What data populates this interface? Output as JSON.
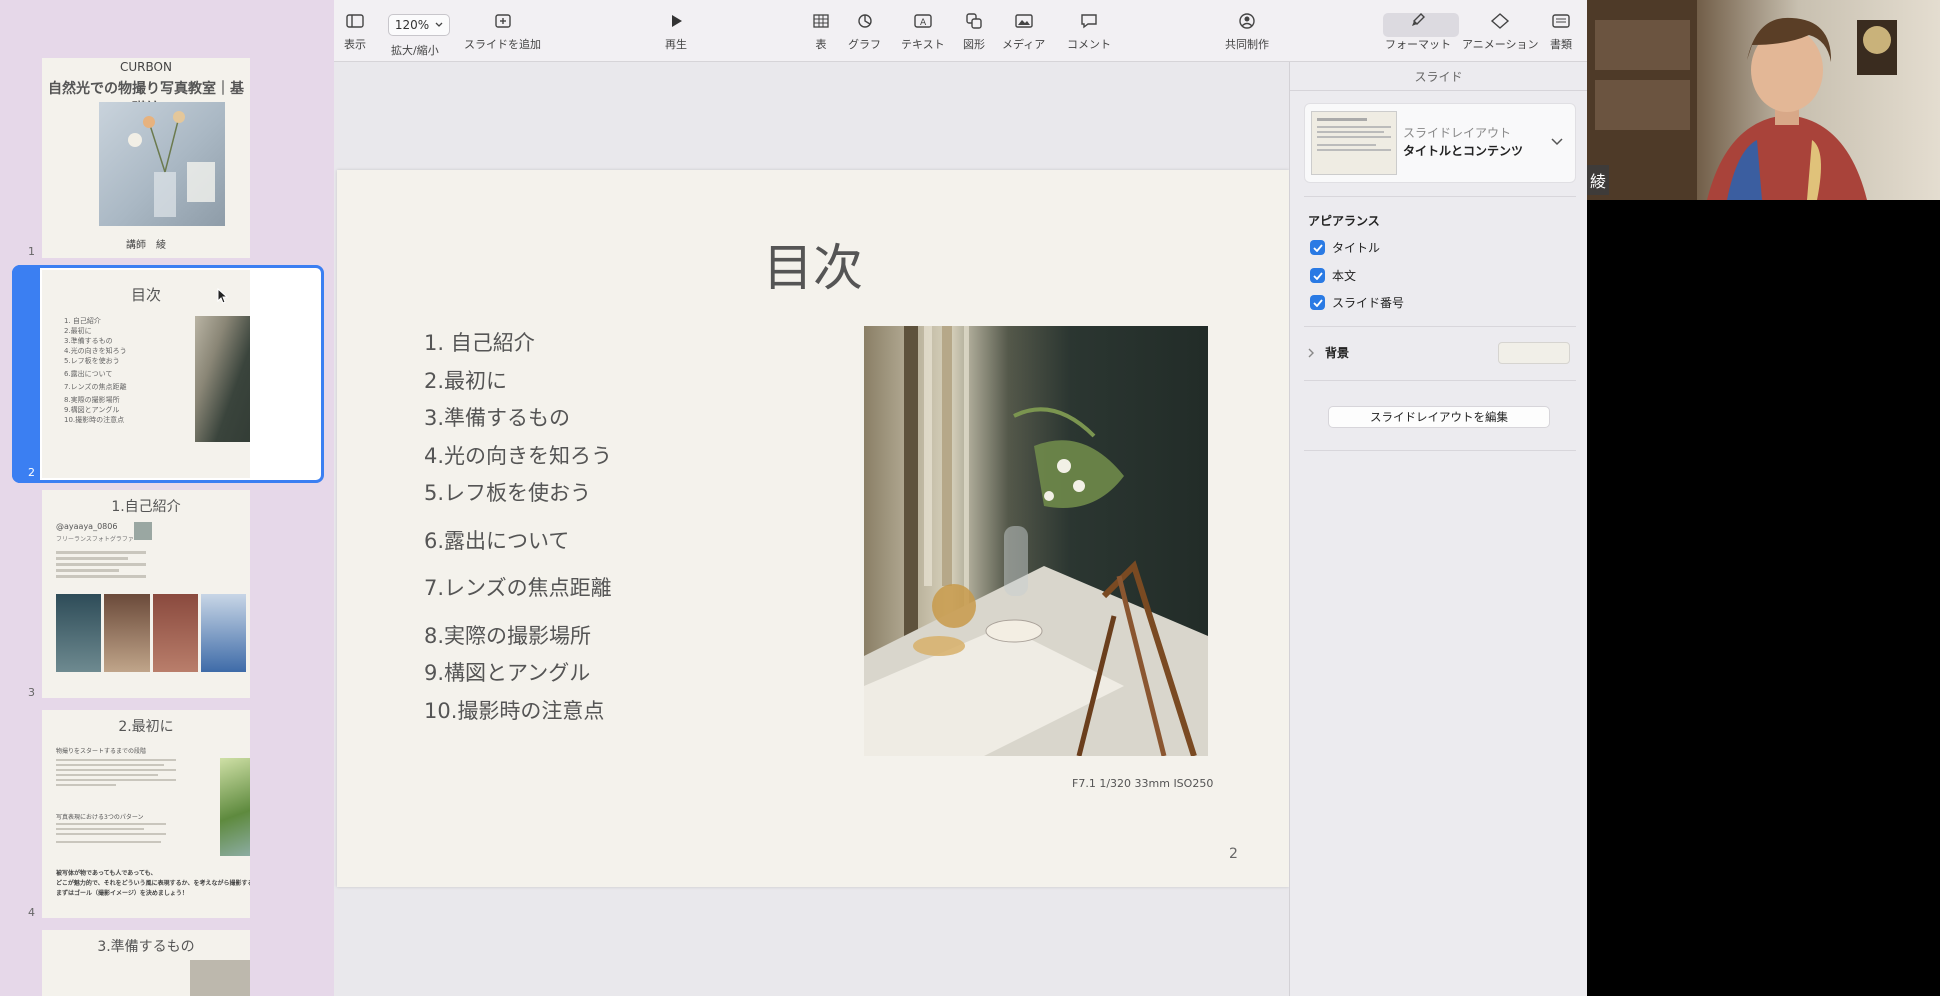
{
  "toolbar": {
    "view_label": "表示",
    "zoom_value": "120%",
    "zoom_label": "拡大/縮小",
    "add_slide_label": "スライドを追加",
    "play_label": "再生",
    "table_label": "表",
    "chart_label": "グラフ",
    "text_label": "テキスト",
    "shape_label": "図形",
    "media_label": "メディア",
    "comment_label": "コメント",
    "collaborate_label": "共同制作",
    "format_label": "フォーマット",
    "animate_label": "アニメーション",
    "document_label": "書類"
  },
  "sidebar": {
    "slides": [
      {
        "num": "1",
        "brand": "CURBON",
        "title": "自然光での物撮り写真教室｜基礎編",
        "lecturer": "講師　綾"
      },
      {
        "num": "2",
        "title": "目次",
        "items": [
          "1. 自己紹介",
          "2.最初に",
          "3.準備するもの",
          "4.光の向きを知ろう",
          "5.レフ板を使おう",
          "6.露出について",
          "7.レンズの焦点距離",
          "8.実際の撮影場所",
          "9.構図とアングル",
          "10.撮影時の注意点"
        ]
      },
      {
        "num": "3",
        "title": "1.自己紹介",
        "handle": "@ayaaya_0806",
        "role": "フリーランスフォトグラファー"
      },
      {
        "num": "4",
        "title": "2.最初に",
        "subhead1": "物撮りをスタートするまでの段階",
        "subhead2": "写真表現における3つのパターン",
        "footer1": "被写体が物であっても人であっても、",
        "footer2": "どこが魅力的で、それをどういう風に表現するか、を考えながら撮影する。",
        "footer3": "まずはゴール（撮影イメージ）を決めましょう！"
      },
      {
        "num": "5",
        "title": "3.準備するもの"
      }
    ]
  },
  "slide": {
    "title": "目次",
    "toc": [
      "1. 自己紹介",
      "2.最初に",
      "3.準備するもの",
      "4.光の向きを知ろう",
      "5.レフ板を使おう",
      "6.露出について",
      "7.レンズの焦点距離",
      "8.実際の撮影場所",
      "9.構図とアングル",
      "10.撮影時の注意点"
    ],
    "caption": "F7.1 1/320 33mm ISO250",
    "number": "2"
  },
  "inspector": {
    "header": "スライド",
    "layout_label": "スライドレイアウト",
    "layout_value": "タイトルとコンテンツ",
    "appearance_label": "アピアランス",
    "checks": [
      {
        "label": "タイトル",
        "checked": true
      },
      {
        "label": "本文",
        "checked": true
      },
      {
        "label": "スライド番号",
        "checked": true
      }
    ],
    "background_label": "背景",
    "background_color": "#f1efe8",
    "edit_button": "スライドレイアウトを編集"
  },
  "camera": {
    "name_tag": "綾"
  },
  "colors": {
    "accent": "#2a7ae4",
    "sidebar": "#e6d8e9"
  }
}
